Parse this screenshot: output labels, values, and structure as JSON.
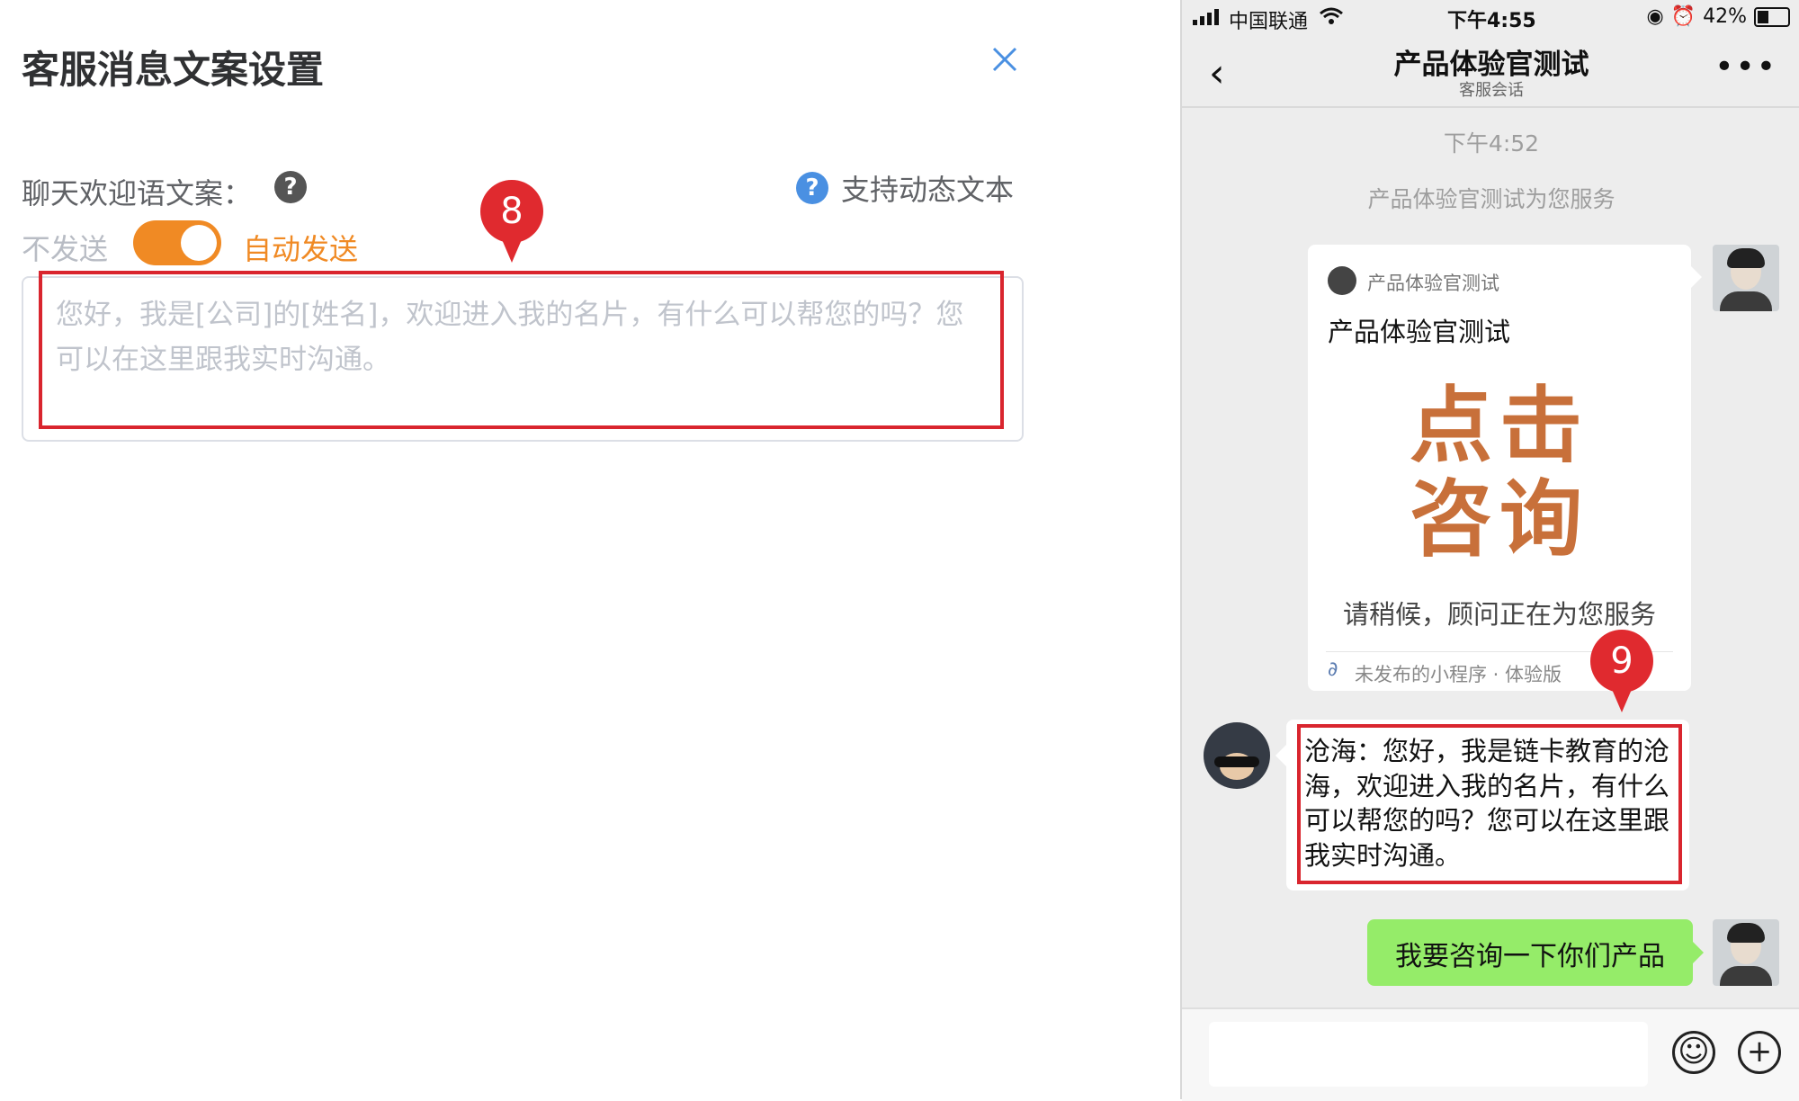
{
  "left_panel": {
    "title": "客服消息文案设置",
    "close_glyph": "×",
    "greeting_label": "聊天欢迎语文案：",
    "help_glyph": "?",
    "dynamic_text_link": "支持动态文本",
    "toggle_off_label": "不发送",
    "toggle_on_label": "自动发送",
    "toggle_state": "on",
    "greeting_placeholder": "您好，我是[公司]的[姓名]，欢迎进入我的名片，有什么可以帮您的吗？您可以在这里跟我实时沟通。",
    "marker": "8"
  },
  "phone": {
    "status": {
      "carrier": "中国联通",
      "time": "下午4:55",
      "battery": "42%",
      "battery_level": 0.42
    },
    "nav": {
      "back_glyph": "‹",
      "title": "产品体验官测试",
      "subtitle": "客服会话",
      "more_glyph": "•••"
    },
    "chat": {
      "timestamp": "下午4:52",
      "system_notice": "产品体验官测试为您服务",
      "mini_program_card": {
        "app_name": "产品体验官测试",
        "title": "产品体验官测试",
        "big_text_line1": "点击",
        "big_text_line2": "咨询",
        "wait_text": "请稍候，顾问正在为您服务",
        "footer": "未发布的小程序 · 体验版"
      },
      "incoming_message": "沧海：您好，我是链卡教育的沧海，欢迎进入我的名片，有什么可以帮您的吗？您可以在这里跟我实时沟通。",
      "outgoing_message": "我要咨询一下你们产品",
      "marker": "9"
    },
    "input_bar": {
      "emoji_glyph": "☺",
      "plus_glyph": "+"
    }
  },
  "colors": {
    "accent_orange": "#f08a24",
    "marker_red": "#e02a2f",
    "wechat_green": "#95ec69",
    "link_blue": "#4a90e2"
  }
}
